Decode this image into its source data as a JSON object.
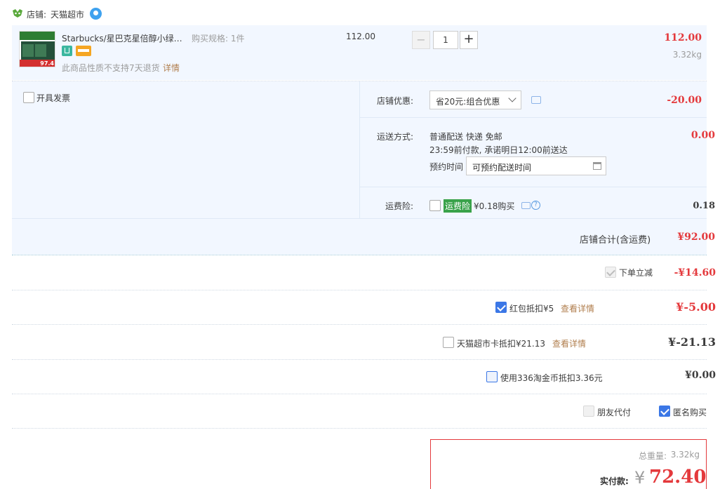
{
  "shop": {
    "prefix": "店铺:",
    "name": "天猫超市"
  },
  "item": {
    "image_badge": "97.4",
    "image_title": "小绿罐",
    "title": "Starbucks/星巴克星倍醇小绿…",
    "spec": "购买规格: 1件",
    "unit_price": "112.00",
    "quantity": "1",
    "minus": "−",
    "plus": "+",
    "total": "112.00",
    "weight": "3.32kg",
    "return_note": "此商品性质不支持7天退货",
    "return_link": "详情"
  },
  "invoice": {
    "label": "开具发票"
  },
  "shop_discount": {
    "label": "店铺优惠:",
    "selected": "省20元:组合优惠",
    "amount": "-20.00"
  },
  "shipping": {
    "label": "运送方式:",
    "method": "普通配送 快递 免邮",
    "promise": "23:59前付款, 承诺明日12:00前送达",
    "schedule_label": "预约时间",
    "schedule_placeholder": "可预约配送时间",
    "amount": "0.00"
  },
  "insurance": {
    "label": "运费险:",
    "badge": "运费险",
    "text": "¥0.18购买",
    "amount": "0.18"
  },
  "shop_total": {
    "label": "店铺合计(含运费)",
    "amount": "¥92.00"
  },
  "instant_discount": {
    "label": "下单立减",
    "amount": "-¥14.60"
  },
  "red_packet": {
    "label": "红包抵扣¥5",
    "link": "查看详情",
    "amount": "¥-5.00"
  },
  "supermarket_card": {
    "label": "天猫超市卡抵扣¥21.13",
    "link": "查看详情",
    "amount": "¥-21.13"
  },
  "taojinbi": {
    "label": "使用336淘金币抵扣3.36元",
    "amount": "¥0.00"
  },
  "options": {
    "friend_pay": "朋友代付",
    "anonymous": "匿名购买"
  },
  "summary": {
    "weight_label": "总重量:",
    "weight": "3.32kg",
    "pay_label": "实付款:",
    "currency": "¥",
    "amount": "72.40"
  },
  "colors": {
    "price_red": "#e4393c",
    "link_brown": "#b07e4d",
    "section_bg": "#f2f7ff",
    "accent_blue": "#3b77e6",
    "badge_green": "#39a24a"
  }
}
